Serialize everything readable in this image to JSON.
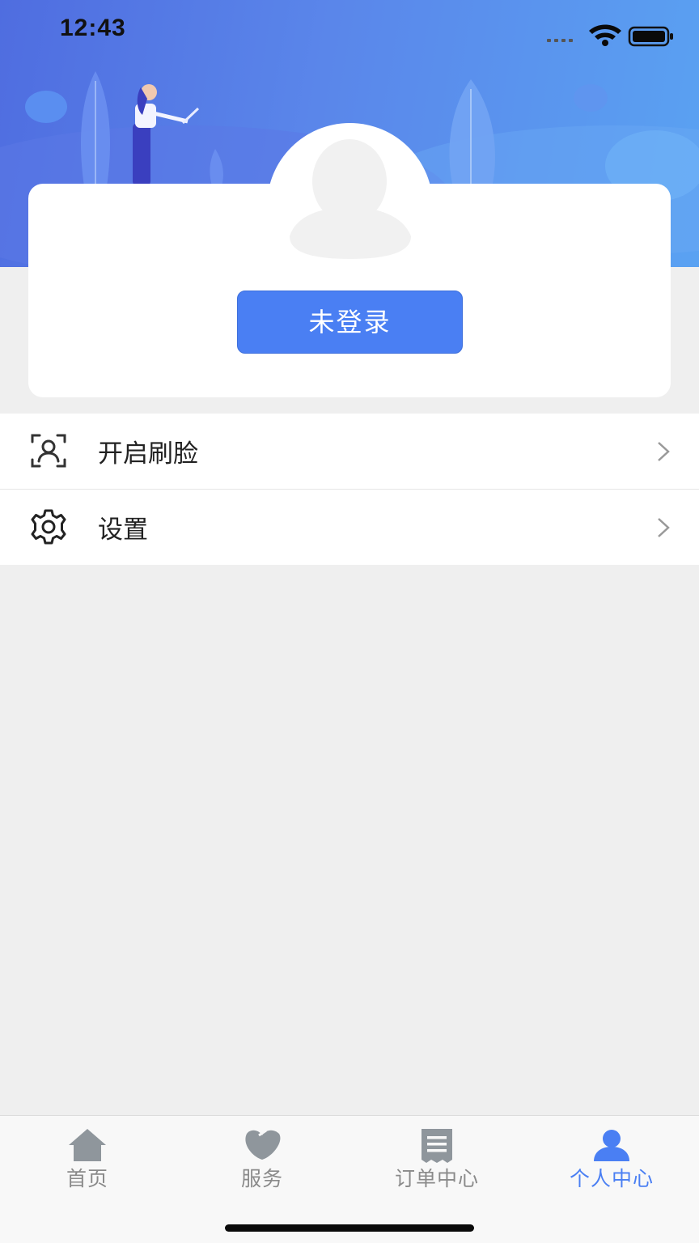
{
  "status_bar": {
    "time": "12:43"
  },
  "profile": {
    "login_button_label": "未登录"
  },
  "menu": {
    "items": [
      {
        "label": "开启刷脸",
        "icon": "face-scan-icon"
      },
      {
        "label": "设置",
        "icon": "gear-icon"
      }
    ]
  },
  "tabbar": {
    "tabs": [
      {
        "label": "首页",
        "icon": "home-icon",
        "active": false
      },
      {
        "label": "服务",
        "icon": "heart-icon",
        "active": false
      },
      {
        "label": "订单中心",
        "icon": "order-list-icon",
        "active": false
      },
      {
        "label": "个人中心",
        "icon": "user-icon",
        "active": true
      }
    ]
  },
  "colors": {
    "accent": "#4a7ff3",
    "header_gradient_start": "#4f6de0",
    "header_gradient_end": "#5aa2f2",
    "background": "#efefef",
    "tab_inactive": "#8a8a8a"
  }
}
